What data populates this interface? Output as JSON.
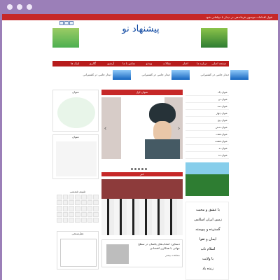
{
  "topbar": {
    "text": "قبول اقدامات موسوی فرماندهی در دیدار با دیپلماتی شود"
  },
  "logo": {
    "text": "پیشنهاد نو"
  },
  "nav": {
    "items": [
      "صفحه اصلی",
      "درباره ما",
      "اخبار",
      "مقالات",
      "ویدئو",
      "تماس با ما",
      "آرشیو",
      "گالری",
      "لینک ها"
    ]
  },
  "news": {
    "items": [
      "دیدار جانبی در کشتیرانی",
      "دیدار جانبی در کشتیرانی",
      "دیدار جانبی در کشتیرانی"
    ]
  },
  "left": {
    "panel1_title": "عنوان",
    "panel2_title": "عنوان",
    "panel3_title": "عنوان",
    "calendar_title": "تقویم شمسی",
    "mini_title": "نظرسنجی"
  },
  "center": {
    "slider_title": "عنوان اول",
    "slider_arrow_left": "‹",
    "slider_arrow_right": "›",
    "featured_title": "خبر",
    "card_title": "دستاورد انتخاب‌های یکسان در سطح جهانی با همکاری اقتصادی",
    "card_sub": "مشاهده بیشتر"
  },
  "right": {
    "list": [
      "عنوان یک",
      "عنوان دو",
      "عنوان سه",
      "عنوان چهار",
      "عنوان پنج",
      "عنوان شش",
      "عنوان هفت",
      "عنوان هشت",
      "عنوان نه",
      "عنوان ده"
    ],
    "poster_lines": [
      "با عشق و محبت",
      "زمین ایران اسلامی",
      "گسترده و پیوسته",
      "ایمان و تقوا",
      "اسلام ناب",
      "با ولایت",
      "زنده باد"
    ]
  }
}
